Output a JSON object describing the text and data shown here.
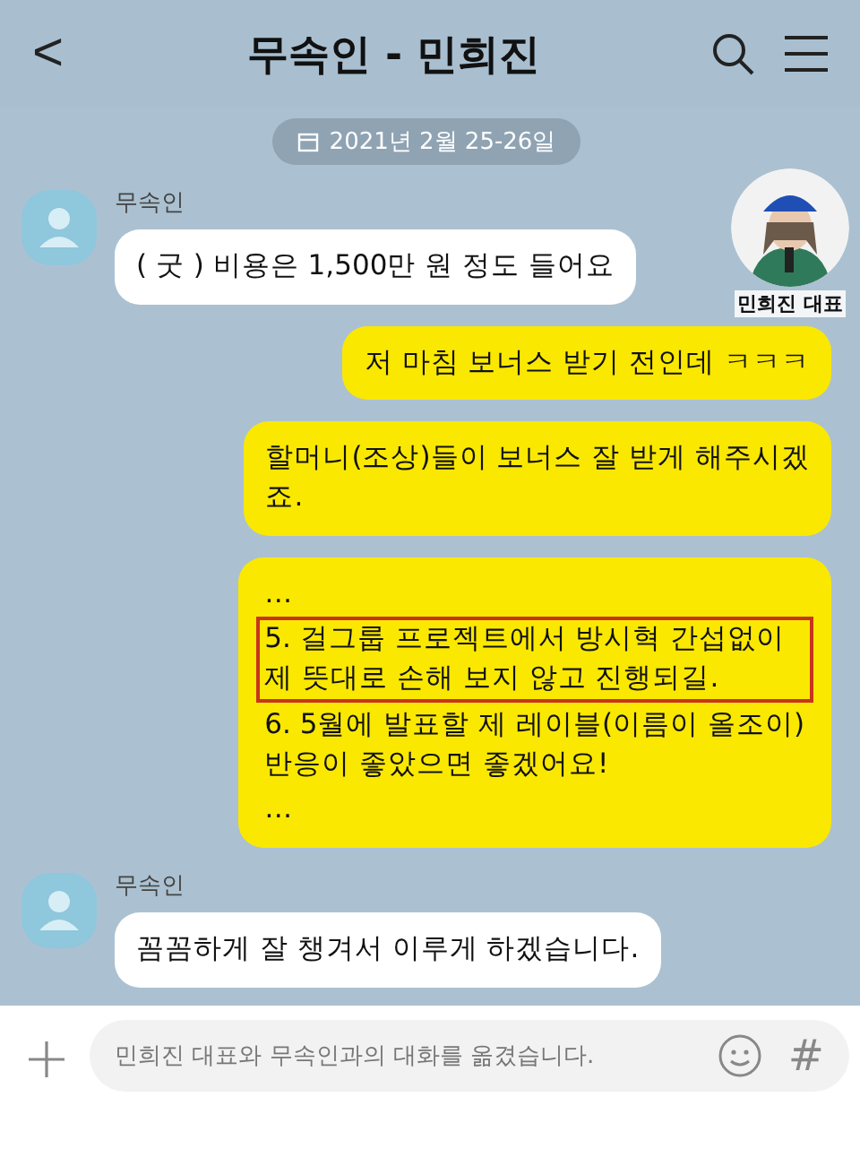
{
  "header": {
    "back": "<",
    "title": "무속인 - 민희진"
  },
  "date_pill": {
    "text": "2021년 2월 25-26일"
  },
  "inset": {
    "kind": "picture",
    "caption": "민희진 대표"
  },
  "messages": [
    {
      "kind": "incoming",
      "sender": "무속인",
      "text": "( 굿 ) 비용은 1,500만 원 정도 들어요"
    },
    {
      "kind": "outgoing",
      "text": "저 마침 보너스 받기 전인데 ㅋㅋㅋ"
    },
    {
      "kind": "outgoing",
      "text": "할머니(조상)들이 보너스 잘 받게 해주시겠\n죠."
    },
    {
      "kind": "outgoing",
      "paragraphs": [
        {
          "text": "…",
          "highlighted": false
        },
        {
          "text": "5. 걸그룹 프로젝트에서 방시혁 간섭없이\n제 뜻대로 손해 보지 않고 진행되길.",
          "highlighted": true
        },
        {
          "text": "6. 5월에 발표할 제 레이블(이름이 올조이)\n반응이 좋았으면 좋겠어요!",
          "highlighted": false
        },
        {
          "text": "…",
          "highlighted": false
        }
      ]
    },
    {
      "kind": "incoming",
      "sender": "무속인",
      "text": "꼼꼼하게 잘 챙겨서 이루게 하겠습니다."
    }
  ],
  "input": {
    "placeholder": "민희진 대표와 무속인과의 대화를 옮겼습니다.",
    "hash": "#"
  }
}
